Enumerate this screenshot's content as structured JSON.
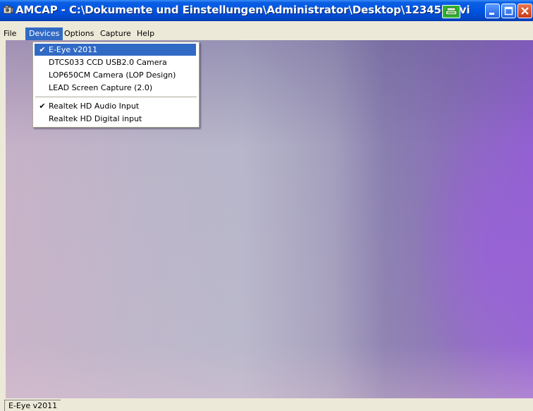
{
  "window": {
    "title": "AMCAP - C:\\Dokumente und Einstellungen\\Administrator\\Desktop\\123456.avi"
  },
  "menubar": {
    "items": [
      {
        "label": "File"
      },
      {
        "label": "Devices",
        "active": true
      },
      {
        "label": "Options"
      },
      {
        "label": "Capture"
      },
      {
        "label": "Help"
      }
    ]
  },
  "devices_menu": {
    "items": [
      {
        "label": "E-Eye v2011",
        "checked": true,
        "highlighted": true
      },
      {
        "label": "DTCS033 CCD USB2.0 Camera",
        "checked": false
      },
      {
        "label": "LOP650CM Camera (LOP Design)",
        "checked": false
      },
      {
        "label": "LEAD Screen Capture (2.0)",
        "checked": false
      },
      {
        "label": "Realtek HD Audio Input",
        "checked": true
      },
      {
        "label": "Realtek HD Digital input",
        "checked": false
      }
    ],
    "check_glyph": "✔"
  },
  "statusbar": {
    "text": "E-Eye v2011"
  },
  "colors": {
    "titlebar": "#0054e3",
    "menu_highlight": "#316ac5",
    "tray_icon": "#31b531",
    "close_button": "#c9391a"
  },
  "icons": {
    "app": "camera-icon",
    "tray": "printer-icon",
    "minimize": "minimize-icon",
    "maximize": "maximize-icon",
    "close": "close-icon"
  }
}
